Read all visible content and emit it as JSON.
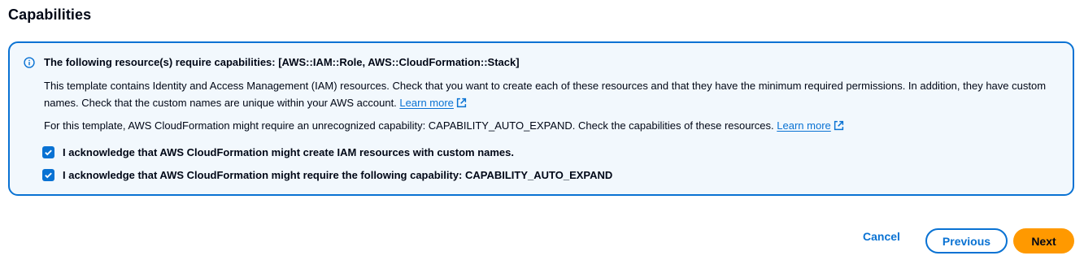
{
  "section": {
    "title": "Capabilities"
  },
  "alert": {
    "header": "The following resource(s) require capabilities: [AWS::IAM::Role, AWS::CloudFormation::Stack]",
    "paragraph1": "This template contains Identity and Access Management (IAM) resources. Check that you want to create each of these resources and that they have the minimum required permissions. In addition, they have custom names. Check that the custom names are unique within your AWS account.",
    "paragraph1_link": "Learn more",
    "paragraph2": "For this template, AWS CloudFormation might require an unrecognized capability: CAPABILITY_AUTO_EXPAND. Check the capabilities of these resources.",
    "paragraph2_link": "Learn more",
    "checkboxes": [
      {
        "label": "I acknowledge that AWS CloudFormation might create IAM resources with custom names.",
        "checked": true
      },
      {
        "label": "I acknowledge that AWS CloudFormation might require the following capability: CAPABILITY_AUTO_EXPAND",
        "checked": true
      }
    ],
    "icons": {
      "status": "info-icon",
      "external": "external-link-icon"
    }
  },
  "actions": {
    "cancel": "Cancel",
    "previous": "Previous",
    "next": "Next"
  },
  "colors": {
    "accent": "#0972d3",
    "alert_background": "#f2f8fd",
    "primary_button": "#ff9900"
  }
}
